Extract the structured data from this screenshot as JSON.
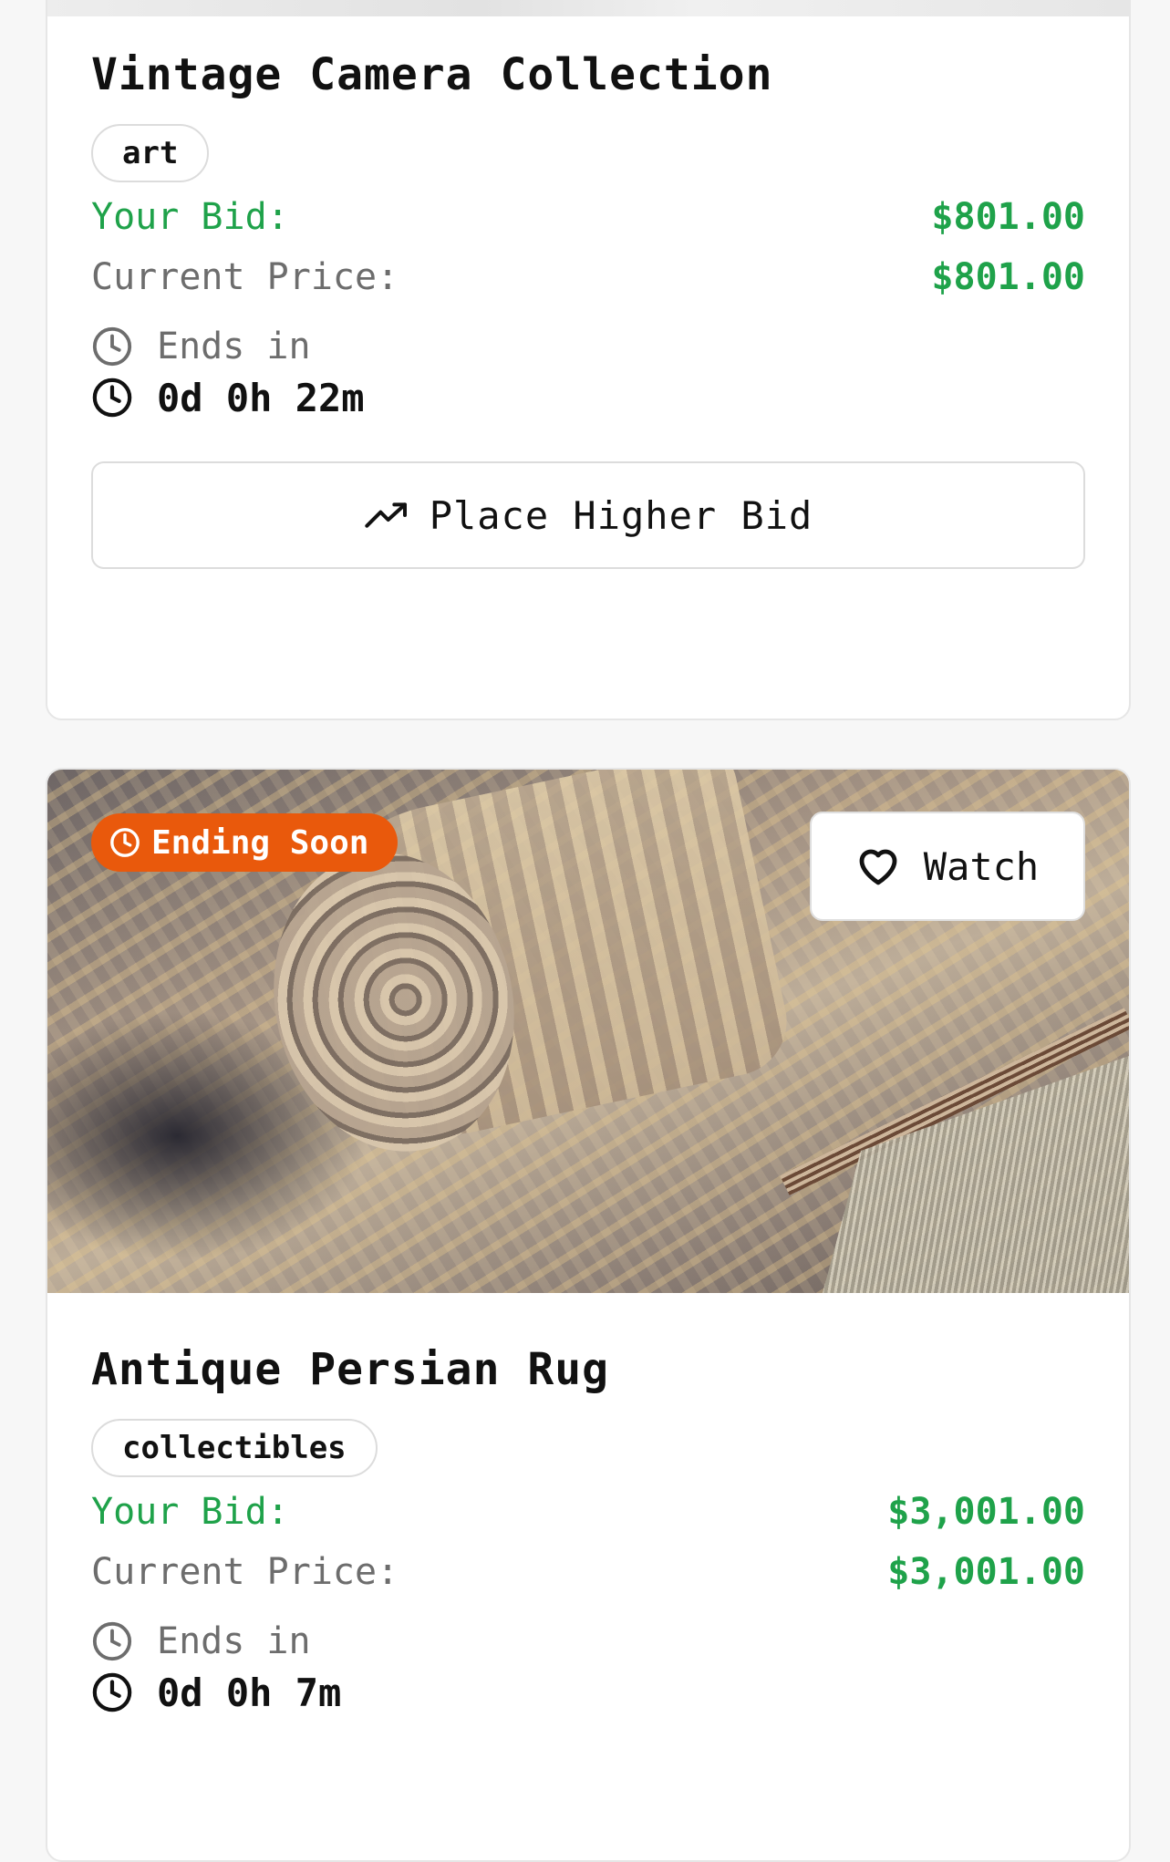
{
  "cards": [
    {
      "title": "Vintage Camera Collection",
      "tag": "art",
      "your_bid_label": "Your Bid:",
      "your_bid_value": "$801.00",
      "current_price_label": "Current Price:",
      "current_price_value": "$801.00",
      "ends_label": "Ends in",
      "time_left": "0d 0h 22m",
      "bid_button_label": "Place Higher Bid"
    },
    {
      "badge": "Ending Soon",
      "watch_label": "Watch",
      "title": "Antique Persian Rug",
      "tag": "collectibles",
      "your_bid_label": "Your Bid:",
      "your_bid_value": "$3,001.00",
      "current_price_label": "Current Price:",
      "current_price_value": "$3,001.00",
      "ends_label": "Ends in",
      "time_left": "0d 0h 7m"
    }
  ],
  "colors": {
    "price_green": "#1fa24a",
    "badge_orange": "#e9590c"
  },
  "icons": [
    "clock-icon",
    "trending-up-icon",
    "heart-icon"
  ]
}
